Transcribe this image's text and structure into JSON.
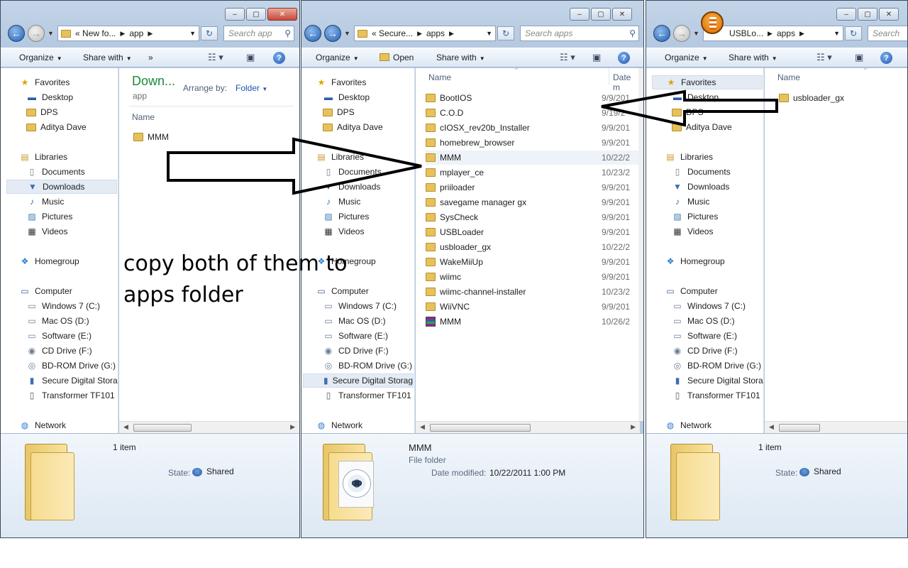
{
  "annotation": "copy both of them to apps folder",
  "windows": [
    {
      "address": [
        "«",
        "New fo...",
        "app"
      ],
      "search_placeholder": "Search app",
      "toolbar": {
        "organize": "Organize",
        "share_with": "Share with",
        "more": "»"
      },
      "library_header": {
        "title": "Down...",
        "subtitle": "app",
        "arrange_label": "Arrange by:",
        "arrange_value": "Folder"
      },
      "column_name": "Name",
      "files": [
        {
          "name": "MMM"
        }
      ],
      "details": {
        "count": "1 item",
        "state_label": "State:",
        "state_value": "Shared"
      }
    },
    {
      "address": [
        "«",
        "Secure...",
        "apps"
      ],
      "search_placeholder": "Search apps",
      "toolbar": {
        "organize": "Organize",
        "open": "Open",
        "share_with": "Share with"
      },
      "column_name": "Name",
      "column_date": "Date m",
      "files": [
        {
          "name": "BootIOS",
          "date": "9/9/201"
        },
        {
          "name": "C.O.D",
          "date": "9/19/2"
        },
        {
          "name": "cIOSX_rev20b_Installer",
          "date": "9/9/201"
        },
        {
          "name": "homebrew_browser",
          "date": "9/9/201"
        },
        {
          "name": "MMM",
          "date": "10/22/2"
        },
        {
          "name": "mplayer_ce",
          "date": "10/23/2"
        },
        {
          "name": "priiloader",
          "date": "9/9/201"
        },
        {
          "name": "savegame manager gx",
          "date": "9/9/201"
        },
        {
          "name": "SysCheck",
          "date": "9/9/201"
        },
        {
          "name": "USBLoader",
          "date": "9/9/201"
        },
        {
          "name": "usbloader_gx",
          "date": "10/22/2"
        },
        {
          "name": "WakeMiiUp",
          "date": "9/9/201"
        },
        {
          "name": "wiimc",
          "date": "9/9/201"
        },
        {
          "name": "wiimc-channel-installer",
          "date": "10/23/2"
        },
        {
          "name": "WiiVNC",
          "date": "9/9/201"
        },
        {
          "name": "MMM",
          "date": "10/26/2",
          "type": "archive"
        }
      ],
      "details": {
        "name": "MMM",
        "type": "File folder",
        "modified_label": "Date modified:",
        "modified_value": "10/22/2011 1:00 PM"
      }
    },
    {
      "address": [
        "USBLo...",
        "apps"
      ],
      "search_placeholder": "Search",
      "toolbar": {
        "organize": "Organize",
        "share_with": "Share with"
      },
      "column_name": "Name",
      "files": [
        {
          "name": "usbloader_gx"
        }
      ],
      "details": {
        "count": "1 item",
        "state_label": "State:",
        "state_value": "Shared"
      }
    }
  ],
  "nav": {
    "favorites": "Favorites",
    "desktop": "Desktop",
    "dps": "DPS",
    "user": "Aditya Dave",
    "libraries": "Libraries",
    "documents": "Documents",
    "downloads": "Downloads",
    "music": "Music",
    "pictures": "Pictures",
    "videos": "Videos",
    "homegroup": "Homegroup",
    "computer": "Computer",
    "drive_c": "Windows 7 (C:)",
    "drive_d": "Mac OS (D:)",
    "drive_e": "Software (E:)",
    "drive_f": "CD Drive (F:)",
    "drive_g": "BD-ROM Drive (G:)",
    "sd": "Secure Digital Storag",
    "transformer": "Transformer TF101",
    "network": "Network"
  },
  "colors": {
    "accent": "#2b5fa6",
    "title_bar": "#b5c9e0",
    "folder": "#e7c15a",
    "library_title": "#1a8a3a"
  }
}
